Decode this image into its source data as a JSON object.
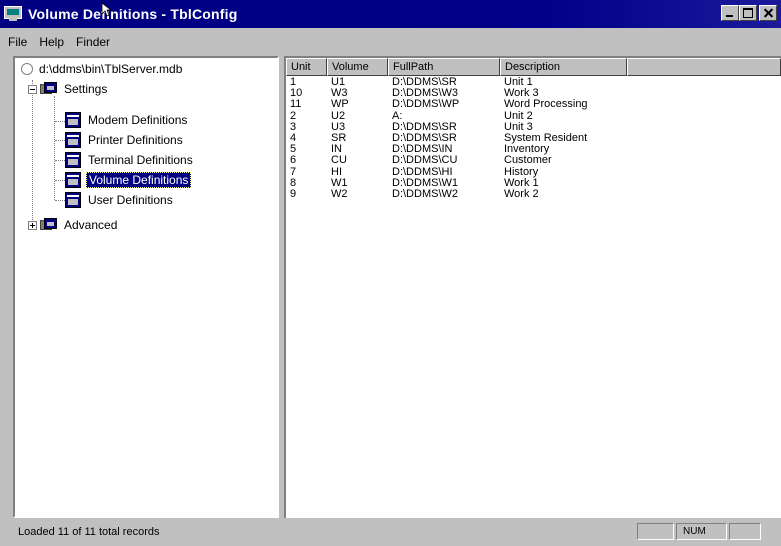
{
  "window": {
    "title": "Volume Definitions - TblConfig"
  },
  "menu": [
    "File",
    "Help",
    "Finder"
  ],
  "tree": {
    "root": "d:\\ddms\\bin\\TblServer.mdb",
    "settings": "Settings",
    "children": [
      "Modem Definitions",
      "Printer Definitions",
      "Terminal Definitions",
      "Volume Definitions",
      "User Definitions"
    ],
    "selected_index": 3,
    "advanced": "Advanced"
  },
  "list": {
    "columns": [
      "Unit",
      "Volume",
      "FullPath",
      "Description",
      ""
    ],
    "rows": [
      [
        "1",
        "U1",
        "D:\\DDMS\\SR",
        "Unit 1"
      ],
      [
        "10",
        "W3",
        "D:\\DDMS\\W3",
        "Work 3"
      ],
      [
        "11",
        "WP",
        "D:\\DDMS\\WP",
        "Word Processing"
      ],
      [
        "2",
        "U2",
        "A:",
        "Unit 2"
      ],
      [
        "3",
        "U3",
        "D:\\DDMS\\SR",
        "Unit 3"
      ],
      [
        "4",
        "SR",
        "D:\\DDMS\\SR",
        "System Resident"
      ],
      [
        "5",
        "IN",
        "D:\\DDMS\\IN",
        "Inventory"
      ],
      [
        "6",
        "CU",
        "D:\\DDMS\\CU",
        "Customer"
      ],
      [
        "7",
        "HI",
        "D:\\DDMS\\HI",
        "History"
      ],
      [
        "8",
        "W1",
        "D:\\DDMS\\W1",
        "Work 1"
      ],
      [
        "9",
        "W2",
        "D:\\DDMS\\W2",
        "Work 2"
      ]
    ]
  },
  "status": {
    "text": "Loaded 11 of 11 total records",
    "num": "NUM"
  }
}
